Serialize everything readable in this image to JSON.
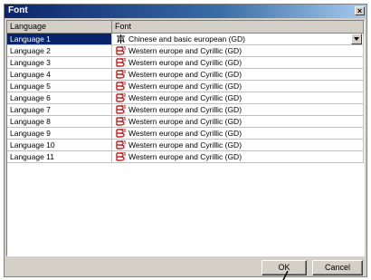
{
  "window": {
    "title": "Font"
  },
  "grid": {
    "headers": {
      "language": "Language",
      "font": "Font"
    },
    "rows": [
      {
        "language": "Language 1",
        "font": "Chinese and basic european (GD)",
        "icon": "chinese-char-icon",
        "selected": true
      },
      {
        "language": "Language 2",
        "font": "Western europe and Cyrillic (GD)",
        "icon": "font-b-icon"
      },
      {
        "language": "Language 3",
        "font": "Western europe and Cyrillic (GD)",
        "icon": "font-b-icon"
      },
      {
        "language": "Language 4",
        "font": "Western europe and Cyrillic (GD)",
        "icon": "font-b-icon"
      },
      {
        "language": "Language 5",
        "font": "Western europe and Cyrillic (GD)",
        "icon": "font-b-icon"
      },
      {
        "language": "Language 6",
        "font": "Western europe and Cyrillic (GD)",
        "icon": "font-b-icon"
      },
      {
        "language": "Language 7",
        "font": "Western europe and Cyrillic (GD)",
        "icon": "font-b-icon"
      },
      {
        "language": "Language 8",
        "font": "Western europe and Cyrillic (GD)",
        "icon": "font-b-icon"
      },
      {
        "language": "Language 9",
        "font": "Western europe and Cyrillic (GD)",
        "icon": "font-b-icon"
      },
      {
        "language": "Language 10",
        "font": "Western europe and Cyrillic (GD)",
        "icon": "font-b-icon"
      },
      {
        "language": "Language 11",
        "font": "Western europe and Cyrillic (GD)",
        "icon": "font-b-icon"
      }
    ]
  },
  "buttons": {
    "ok": "OK",
    "cancel": "Cancel"
  },
  "colors": {
    "selection": "#0a246a",
    "face": "#d4d0c8",
    "icon_red": "#cc2020"
  }
}
